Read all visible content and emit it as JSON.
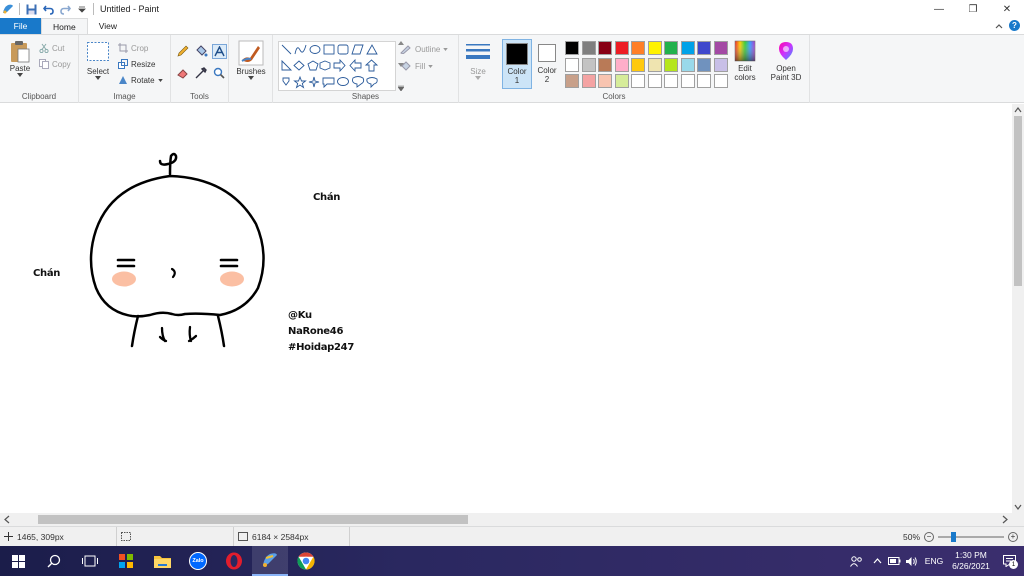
{
  "window": {
    "title": "Untitled - Paint",
    "minimize_glyph": "—",
    "restore_glyph": "❐",
    "close_glyph": "✕"
  },
  "tabs": [
    {
      "label": "File"
    },
    {
      "label": "Home"
    },
    {
      "label": "View"
    }
  ],
  "ribbon": {
    "clipboard": {
      "label": "Clipboard",
      "paste": "Paste",
      "cut": "Cut",
      "copy": "Copy"
    },
    "image": {
      "label": "Image",
      "select": "Select",
      "crop": "Crop",
      "resize": "Resize",
      "rotate": "Rotate"
    },
    "tools": {
      "label": "Tools"
    },
    "brushes": {
      "label": "Brushes"
    },
    "shapes": {
      "label": "Shapes",
      "outline": "Outline",
      "fill": "Fill"
    },
    "size": {
      "label": "Size"
    },
    "colors": {
      "label": "Colors",
      "color1": "Color\n1",
      "color1_line1": "Color",
      "color1_line2": "1",
      "color2_line1": "Color",
      "color2_line2": "2",
      "edit_colors_line1": "Edit",
      "edit_colors_line2": "colors",
      "open_paint3d_line1": "Open",
      "open_paint3d_line2": "Paint 3D",
      "color1_value": "#000000",
      "color2_value": "#ffffff",
      "palette_row1": [
        "#000000",
        "#7f7f7f",
        "#880015",
        "#ed1c24",
        "#ff7f27",
        "#fff200",
        "#22b14c",
        "#00a2e8",
        "#3f48cc",
        "#a349a4"
      ],
      "palette_row2": [
        "#ffffff",
        "#c3c3c3",
        "#b97a57",
        "#ffaec9",
        "#ffc90e",
        "#efe4b0",
        "#b5e61d",
        "#99d9ea",
        "#7092be",
        "#c8bfe7"
      ],
      "palette_row3": [
        "#c8a08a",
        "#f4a3a3",
        "#f8c4b0",
        "#d6ec9a",
        "#ffffff",
        "#ffffff",
        "#ffffff",
        "#ffffff",
        "#ffffff",
        "#ffffff"
      ]
    }
  },
  "canvas": {
    "text_chan_right": "Chán",
    "text_chan_left": "Chán",
    "text_line1": "@Ku",
    "text_line2": "NaRone46",
    "text_line3": "#Hoidap247"
  },
  "statusbar": {
    "cursor_pos": "1465, 309px",
    "image_size": "6184 × 2584px",
    "zoom": "50%"
  },
  "taskbar": {
    "lang": "ENG",
    "time": "1:30 PM",
    "date": "6/26/2021",
    "notification_count": "1",
    "zalo_label": "Zalo"
  }
}
